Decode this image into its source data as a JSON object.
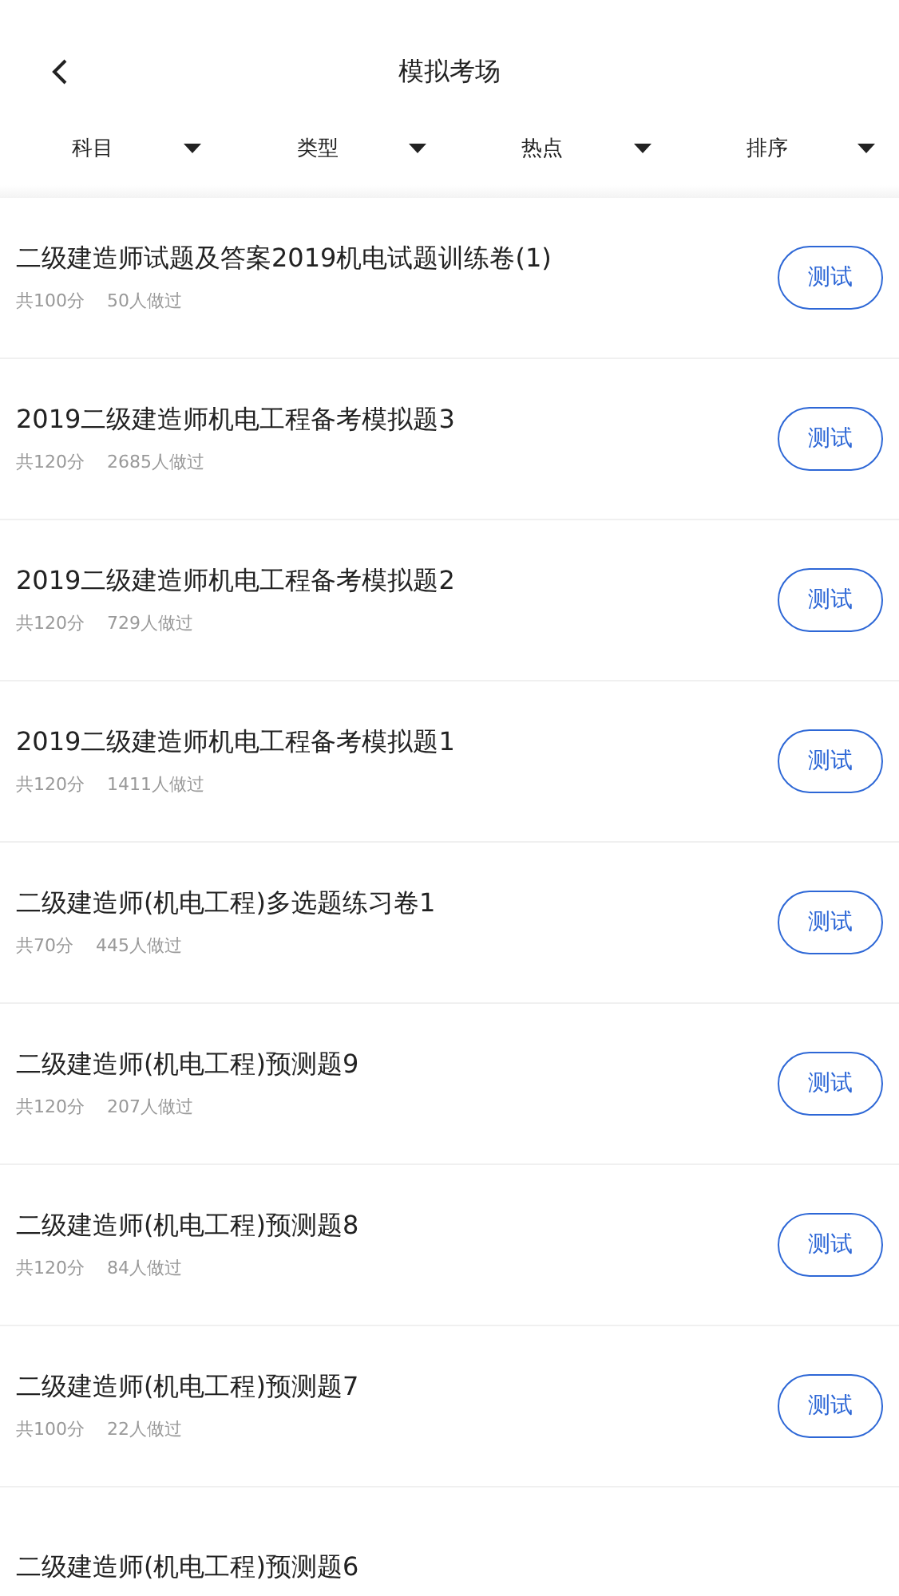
{
  "header": {
    "title": "模拟考场"
  },
  "filters": [
    {
      "label": "科目"
    },
    {
      "label": "类型"
    },
    {
      "label": "热点"
    },
    {
      "label": "排序"
    }
  ],
  "exams": [
    {
      "title": "二级建造师试题及答案2019机电试题训练卷(1)",
      "score": "共100分",
      "taken": "50人做过",
      "button": "测试"
    },
    {
      "title": "2019二级建造师机电工程备考模拟题3",
      "score": "共120分",
      "taken": "2685人做过",
      "button": "测试"
    },
    {
      "title": "2019二级建造师机电工程备考模拟题2",
      "score": "共120分",
      "taken": "729人做过",
      "button": "测试"
    },
    {
      "title": "2019二级建造师机电工程备考模拟题1",
      "score": "共120分",
      "taken": "1411人做过",
      "button": "测试"
    },
    {
      "title": "二级建造师(机电工程)多选题练习卷1",
      "score": "共70分",
      "taken": "445人做过",
      "button": "测试"
    },
    {
      "title": "二级建造师(机电工程)预测题9",
      "score": "共120分",
      "taken": "207人做过",
      "button": "测试"
    },
    {
      "title": "二级建造师(机电工程)预测题8",
      "score": "共120分",
      "taken": "84人做过",
      "button": "测试"
    },
    {
      "title": "二级建造师(机电工程)预测题7",
      "score": "共100分",
      "taken": "22人做过",
      "button": "测试"
    },
    {
      "title": "二级建造师(机电工程)预测题6"
    }
  ]
}
